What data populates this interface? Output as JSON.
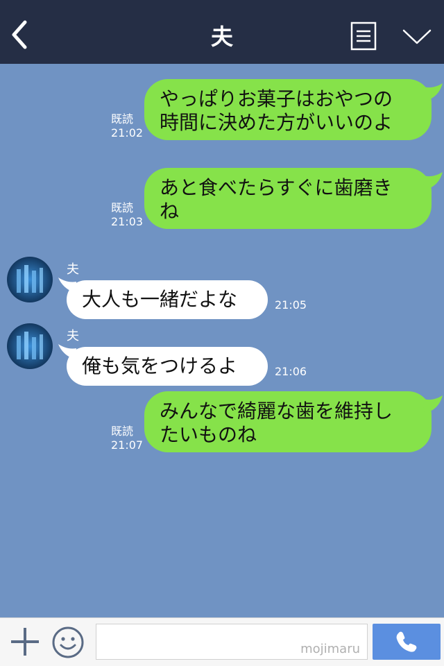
{
  "header": {
    "title": "夫"
  },
  "messages": [
    {
      "side": "out",
      "text": "やっぱりお菓子はおやつの\n時間に決めた方がいいのよ",
      "read": "既読",
      "time": "21:02"
    },
    {
      "side": "out",
      "text": "あと食べたらすぐに歯磨き\nね",
      "read": "既読",
      "time": "21:03"
    },
    {
      "side": "in",
      "name": "夫",
      "text": "大人も一緒だよな",
      "time": "21:05"
    },
    {
      "side": "in",
      "name": "夫",
      "text": "俺も気をつけるよ",
      "time": "21:06"
    },
    {
      "side": "out",
      "text": "みんなで綺麗な歯を維持し\nたいものね",
      "read": "既読",
      "time": "21:07"
    }
  ],
  "footer": {
    "watermark": "mojimaru"
  },
  "colors": {
    "header_bg": "#252e45",
    "chat_bg": "#7093c3",
    "out_bubble": "#86e24a",
    "in_bubble": "#ffffff",
    "call_button": "#5b8fe0"
  },
  "icons": {
    "back": "chevron-left-icon",
    "memo": "note-icon",
    "menu": "chevron-down-icon",
    "plus": "plus-icon",
    "emoji": "smile-icon",
    "call": "phone-icon"
  }
}
